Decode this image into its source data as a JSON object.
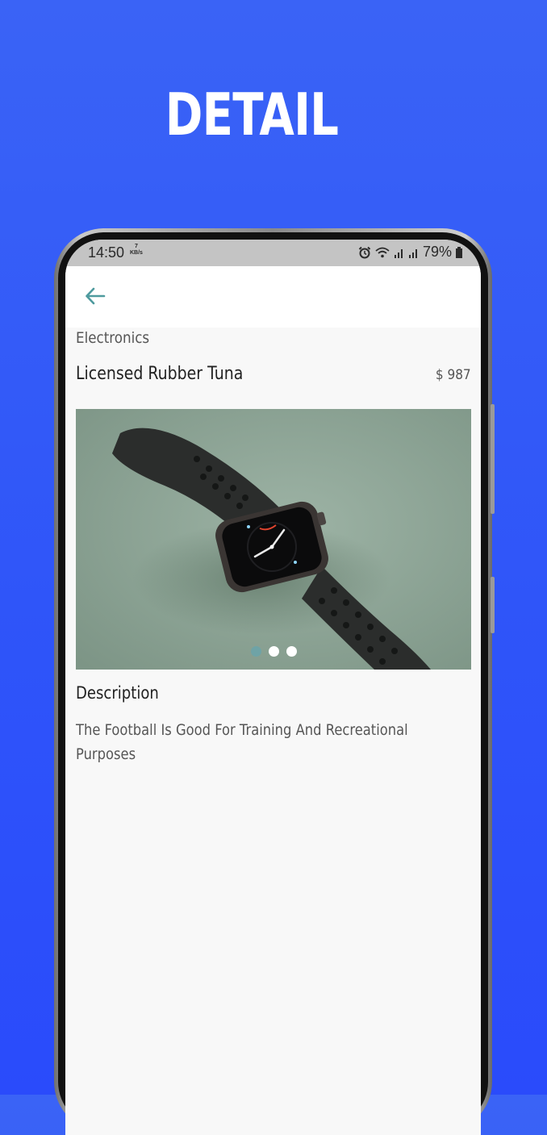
{
  "banner": {
    "headline": "DETAIL"
  },
  "status_bar": {
    "time": "14:50",
    "speed_value": "7",
    "speed_unit": "KB/s",
    "battery": "79%"
  },
  "app_bar": {
    "back_icon": "arrow-left-icon"
  },
  "product": {
    "category": "Electronics",
    "name": "Licensed Rubber Tuna",
    "price": "$ 987",
    "image_subject": "smartwatch-photo",
    "carousel": {
      "slide_count": 3,
      "active_index": 0
    },
    "description_heading": "Description",
    "description": "The Football Is Good For Training And Recreational Purposes"
  },
  "colors": {
    "background": "#3a63f6",
    "accent": "#4e9a9e",
    "screen": "#f8f8f8",
    "status_bar": "#c4c4c4"
  }
}
